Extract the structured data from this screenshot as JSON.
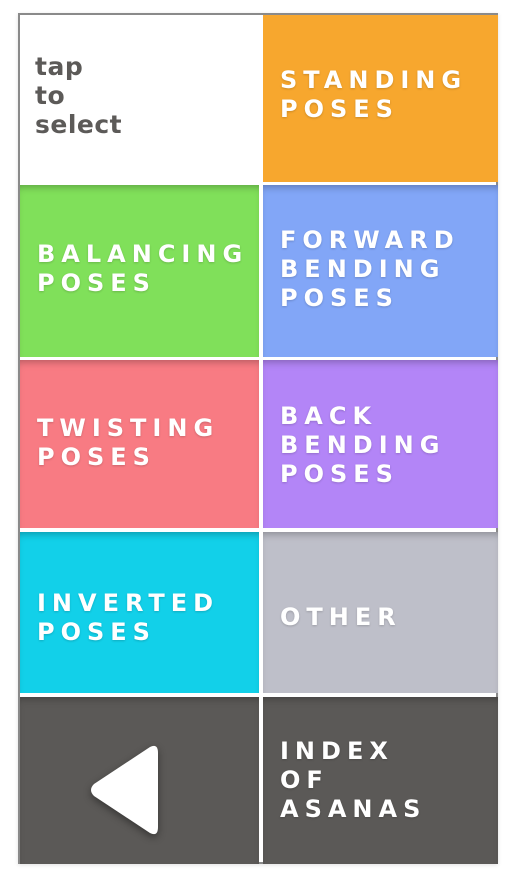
{
  "hint_text": "tap\nto\nselect",
  "categories": [
    {
      "id": "standing",
      "label": "STANDING\nPOSES",
      "color": "#F7A72E"
    },
    {
      "id": "balancing",
      "label": "BALANCING\nPOSES",
      "color": "#80E05A"
    },
    {
      "id": "forward",
      "label": "FORWARD\nBENDING\nPOSES",
      "color": "#82A6F7"
    },
    {
      "id": "twisting",
      "label": "TWISTING\nPOSES",
      "color": "#F87B83"
    },
    {
      "id": "back",
      "label": "BACK\nBENDING\nPOSES",
      "color": "#B385F7"
    },
    {
      "id": "inverted",
      "label": "INVERTED\nPOSES",
      "color": "#12D0E9"
    },
    {
      "id": "other",
      "label": "OTHER",
      "color": "#BEBFC9"
    }
  ],
  "index_label": "INDEX\nOF\nASANAS",
  "nav_color": "#5B5957",
  "back_icon": "back-triangle-icon"
}
